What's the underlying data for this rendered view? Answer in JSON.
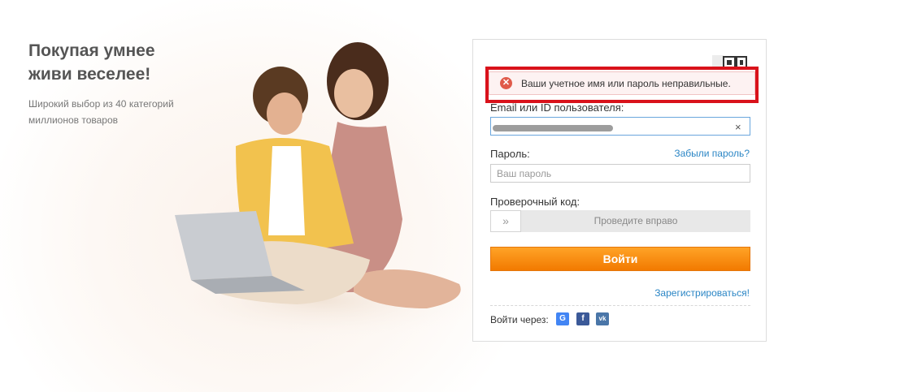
{
  "promo": {
    "headline_line1": "Покупая умнее",
    "headline_line2": "живи веселее!",
    "subline_line1": "Широкий выбор из 40 категорий",
    "subline_line2": "миллионов товаров"
  },
  "login": {
    "qr_icon": "qr-code-icon",
    "error_icon": "error-x-icon",
    "error_message": "Ваши учетное имя или пароль неправильные.",
    "email_label": "Email или ID пользователя:",
    "email_value": "",
    "email_clear": "×",
    "password_label": "Пароль:",
    "forgot_password": "Забыли пароль?",
    "password_placeholder": "Ваш пароль",
    "captcha_label": "Проверочный код:",
    "slider_handle": "»",
    "slider_text": "Проведите вправо",
    "submit_label": "Войти",
    "register_link": "Зарегистрироваться!",
    "social_label": "Войти через:",
    "social": [
      {
        "name": "google",
        "glyph": "G",
        "color": "#4285f4"
      },
      {
        "name": "facebook",
        "glyph": "f",
        "color": "#3b5998"
      },
      {
        "name": "vk",
        "glyph": "vk",
        "color": "#4a76a8"
      }
    ],
    "error_highlight_color": "#d9121b",
    "accent_color": "#f27a00"
  }
}
